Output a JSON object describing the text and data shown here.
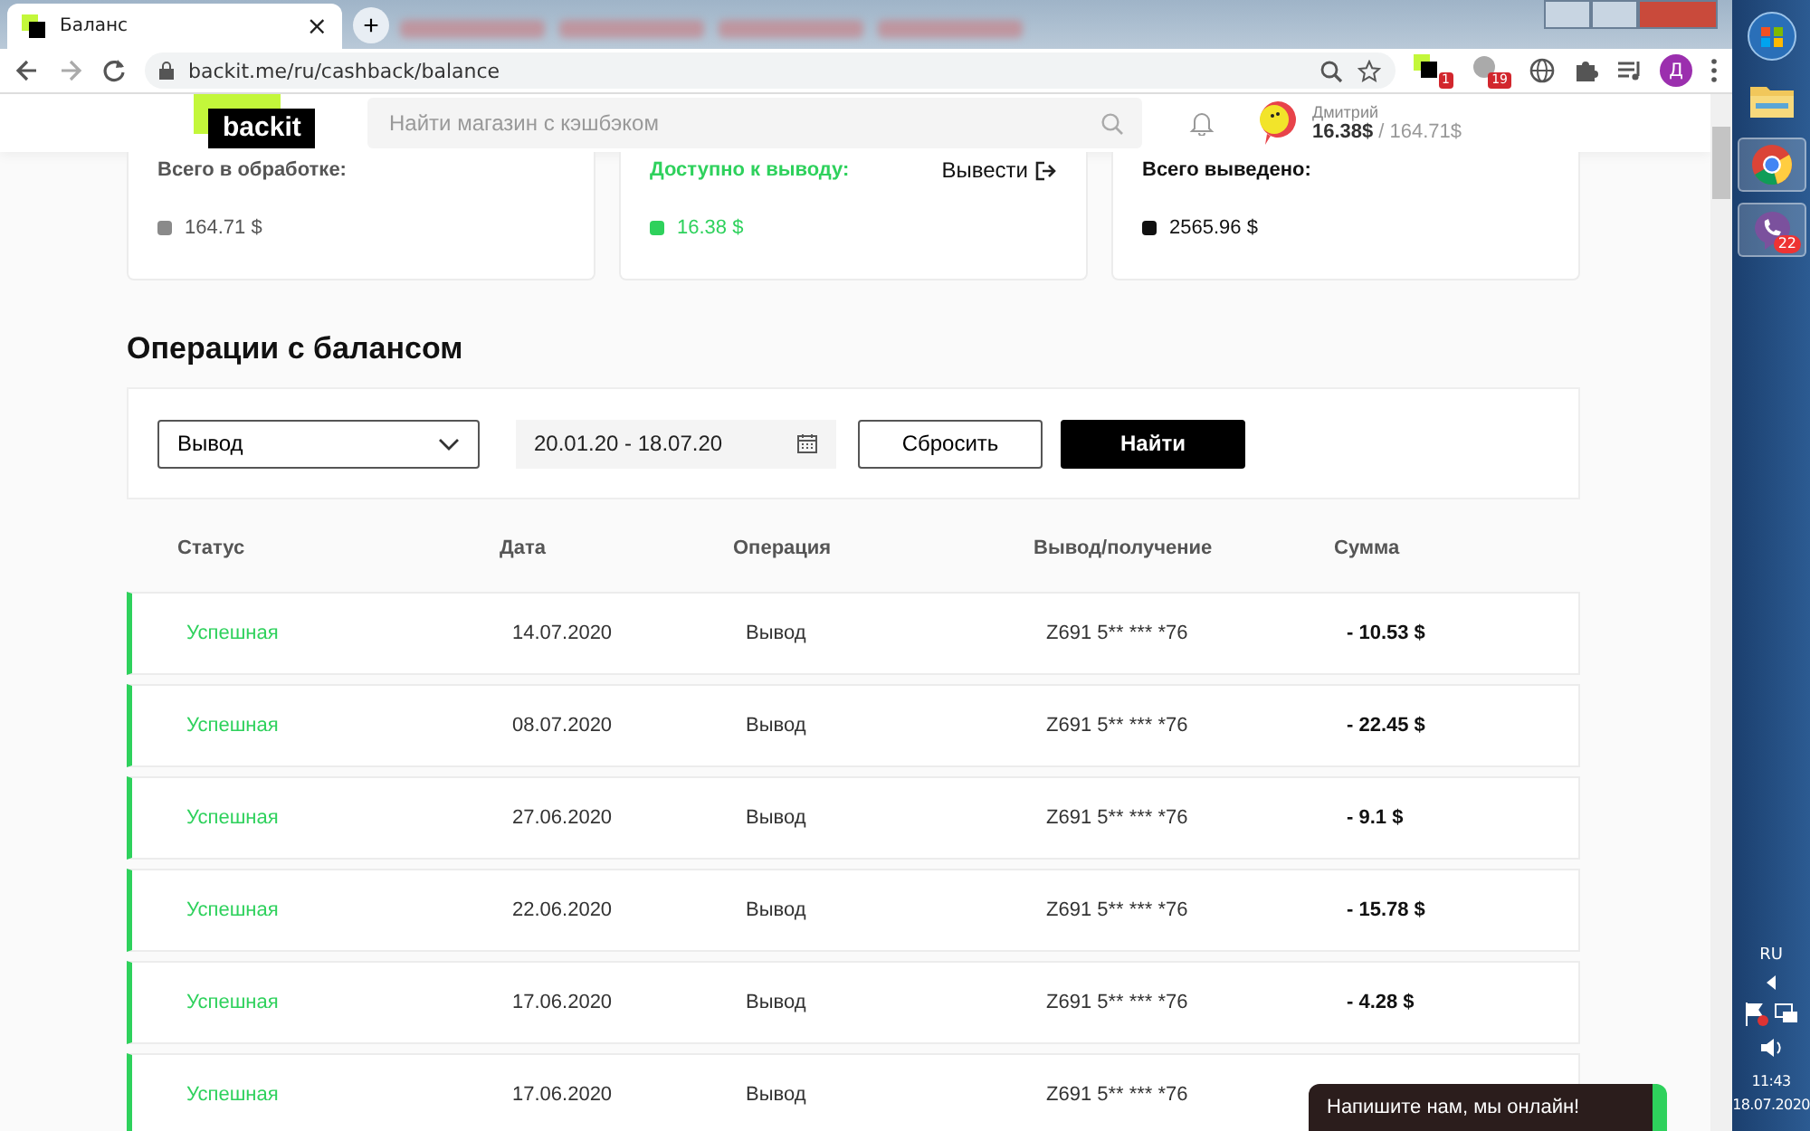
{
  "browser": {
    "tabs": [
      {
        "title": "Баланс",
        "selected": true,
        "close": "×"
      }
    ],
    "new_tab": "+",
    "address": "backit.me/ru/cashback/balance",
    "extension_badges": [
      "1",
      "19"
    ],
    "profile": "Д"
  },
  "header": {
    "logo": "backit",
    "search": {
      "placeholder": "Найти магазин с кэшбэком"
    },
    "user": {
      "name": "Дмитрий",
      "available": "16.38$",
      "total": "/ 164.71$"
    }
  },
  "cards": [
    {
      "title": "Всего в обработке:",
      "amount": "164.71 $",
      "color": "#8a8a8a",
      "kind": "processing"
    },
    {
      "title": "Доступно к выводу:",
      "amount": "16.38 $",
      "color": "#2ed15c",
      "kind": "available",
      "action": "Вывести"
    },
    {
      "title": "Всего выведено:",
      "amount": "2565.96 $",
      "color": "#111111",
      "kind": "withdrawn"
    }
  ],
  "operations": {
    "title": "Операции с балансом",
    "filter": {
      "type": "Вывод",
      "dates": "20.01.20 - 18.07.20",
      "reset": "Сбросить",
      "find": "Найти"
    },
    "columns": [
      "Статус",
      "Дата",
      "Операция",
      "Вывод/получение",
      "Сумма"
    ],
    "rows": [
      {
        "status": "Успешная",
        "kind": "success",
        "date": "14.07.2020",
        "operation": "Вывод",
        "account": "Z691 5** *** *76",
        "sum": "- 10.53 $"
      },
      {
        "status": "Успешная",
        "kind": "success",
        "date": "08.07.2020",
        "operation": "Вывод",
        "account": "Z691 5** *** *76",
        "sum": "- 22.45 $"
      },
      {
        "status": "Успешная",
        "kind": "success",
        "date": "27.06.2020",
        "operation": "Вывод",
        "account": "Z691 5** *** *76",
        "sum": "- 9.1 $"
      },
      {
        "status": "Успешная",
        "kind": "success",
        "date": "22.06.2020",
        "operation": "Вывод",
        "account": "Z691 5** *** *76",
        "sum": "- 15.78 $"
      },
      {
        "status": "Успешная",
        "kind": "success",
        "date": "17.06.2020",
        "operation": "Вывод",
        "account": "Z691 5** *** *76",
        "sum": "- 4.28 $"
      },
      {
        "status": "Успешная",
        "kind": "success",
        "date": "17.06.2020",
        "operation": "Вывод",
        "account": "Z691 5** *** *76"
      }
    ]
  },
  "chat": {
    "text": "Напишите нам, мы онлайн!"
  },
  "taskbar": {
    "viber_badge": "22",
    "language": "RU",
    "time": "11:43",
    "date": "18.07.2020"
  }
}
